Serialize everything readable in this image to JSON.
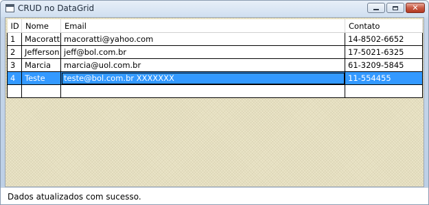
{
  "window": {
    "title": "CRUD no DataGrid",
    "minimize_icon": "minimize-icon",
    "maximize_icon": "maximize-icon",
    "close_icon": "close-icon",
    "close_glyph": "✕"
  },
  "grid": {
    "columns": [
      "ID",
      "Nome",
      "Email",
      "Contato"
    ],
    "rows": [
      {
        "id": "1",
        "nome": "Macoratti",
        "email": "macoratti@yahoo.com",
        "contato": "14-8502-6652"
      },
      {
        "id": "2",
        "nome": "Jefferson",
        "email": "jeff@bol.com.br",
        "contato": "17-5021-6325"
      },
      {
        "id": "3",
        "nome": "Marcia",
        "email": "marcia@uol.com.br",
        "contato": "61-3209-5845"
      },
      {
        "id": "4",
        "nome": "Teste",
        "email": "teste@bol.com.br XXXXXXX",
        "contato": "11-554455"
      }
    ],
    "selected_row": 3,
    "selection_color": "#3399ff",
    "empty_row": {
      "id": "",
      "nome": "",
      "email": "",
      "contato": ""
    }
  },
  "status": {
    "text": "Dados atualizados com sucesso."
  }
}
